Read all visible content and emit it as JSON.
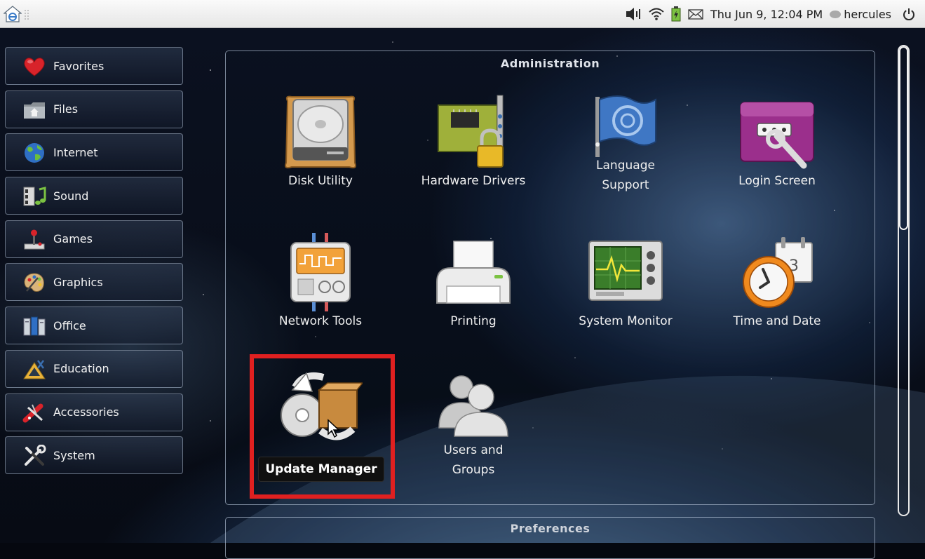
{
  "top_panel": {
    "home_icon": "launcher-home-icon",
    "tray_icons": [
      "volume-icon",
      "wifi-icon",
      "battery-icon",
      "mail-icon"
    ],
    "clock": "Thu Jun  9, 12:04 PM",
    "user": "hercules",
    "power_icon": "power-icon"
  },
  "sidebar": {
    "items": [
      {
        "label": "Favorites",
        "icon": "heart-icon"
      },
      {
        "label": "Files",
        "icon": "folder-icon"
      },
      {
        "label": "Internet",
        "icon": "globe-icon"
      },
      {
        "label": "Sound",
        "icon": "music-icon"
      },
      {
        "label": "Games",
        "icon": "joystick-icon"
      },
      {
        "label": "Graphics",
        "icon": "palette-icon"
      },
      {
        "label": "Office",
        "icon": "office-icon"
      },
      {
        "label": "Education",
        "icon": "education-icon"
      },
      {
        "label": "Accessories",
        "icon": "accessories-icon"
      },
      {
        "label": "System",
        "icon": "tools-icon"
      }
    ]
  },
  "administration": {
    "title": "Administration",
    "apps": [
      {
        "label": "Disk Utility",
        "icon": "hard-disk-icon"
      },
      {
        "label": "Hardware Drivers",
        "icon": "hardware-card-icon"
      },
      {
        "label_line1": "Language",
        "label_line2": "Support",
        "icon": "language-flag-icon"
      },
      {
        "label": "Login Screen",
        "icon": "login-screen-icon"
      },
      {
        "label": "Network Tools",
        "icon": "network-tools-icon"
      },
      {
        "label": "Printing",
        "icon": "printer-icon"
      },
      {
        "label": "System Monitor",
        "icon": "system-monitor-icon"
      },
      {
        "label": "Time and Date",
        "icon": "clock-calendar-icon"
      },
      {
        "label": "Update Manager",
        "icon": "update-manager-icon"
      },
      {
        "label_line1": "Users and",
        "label_line2": "Groups",
        "icon": "users-icon"
      }
    ],
    "tooltip": "Update Manager"
  },
  "preferences": {
    "title": "Preferences"
  },
  "colors": {
    "highlight": "#e02020",
    "panel_border": "#c8d7eb",
    "topbar": "#f0f0f0"
  }
}
